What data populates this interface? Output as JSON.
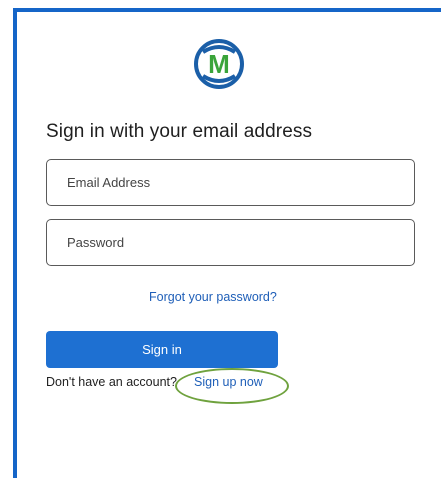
{
  "logo": {
    "icon": "m-logo-icon",
    "letter": "M",
    "colors": {
      "ring": "#1b5fa8",
      "letter": "#3aa43a"
    }
  },
  "form": {
    "heading": "Sign in with your email address",
    "email_placeholder": "Email Address",
    "password_placeholder": "Password",
    "forgot_link": "Forgot your password?",
    "signin_button": "Sign in",
    "no_account_text": "Don't have an account?",
    "signup_link": "Sign up now"
  },
  "colors": {
    "accent": "#1e70d2",
    "frame": "#1565c8",
    "link": "#1f5fb8",
    "highlight_circle": "#6fa23e"
  }
}
